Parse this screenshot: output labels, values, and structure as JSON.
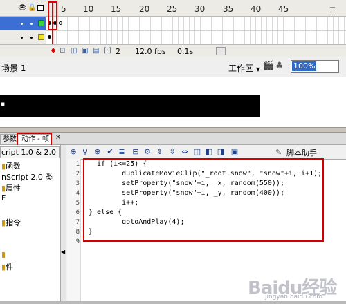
{
  "timeline": {
    "header_icons": [
      "eye-icon",
      "lock-icon",
      "outline-square-icon"
    ],
    "ruler_numbers": [
      "5",
      "10",
      "15",
      "20",
      "25",
      "30",
      "35",
      "40",
      "45"
    ],
    "status": {
      "frame": "2",
      "fps": "12.0 fps",
      "time": "0.1s"
    }
  },
  "editbar": {
    "scene": "场景 1",
    "workspace": "工作区",
    "zoom": "100%"
  },
  "panel": {
    "tab_params": "参数",
    "tab_actions": "动作 - 帧",
    "lang_select": "cript 1.0 & 2.0",
    "tree_items": [
      "函数",
      "nScript 2.0 类",
      "属性",
      "F",
      "指令",
      "",
      "件"
    ],
    "script_assistant": "脚本助手"
  },
  "code": {
    "line_numbers": [
      "1",
      "2",
      "3",
      "4",
      "5",
      "6",
      "7",
      "8",
      "9"
    ],
    "lines": [
      "  if (i<=25) {",
      "        duplicateMovieClip(\"_root.snow\", \"snow\"+i, i+1);",
      "        setProperty(\"snow\"+i, _x, random(550));",
      "        setProperty(\"snow\"+i, _y, random(400));",
      "        i++;",
      "} else {",
      "        gotoAndPlay(4);",
      "}",
      ""
    ]
  },
  "watermark": {
    "brand": "Baidu经验",
    "url": "jingyan.baidu.com"
  },
  "colors": {
    "highlight": "#d40000",
    "layer_selected": "#3b6fd3",
    "zoom_selected": "#3169c6"
  }
}
